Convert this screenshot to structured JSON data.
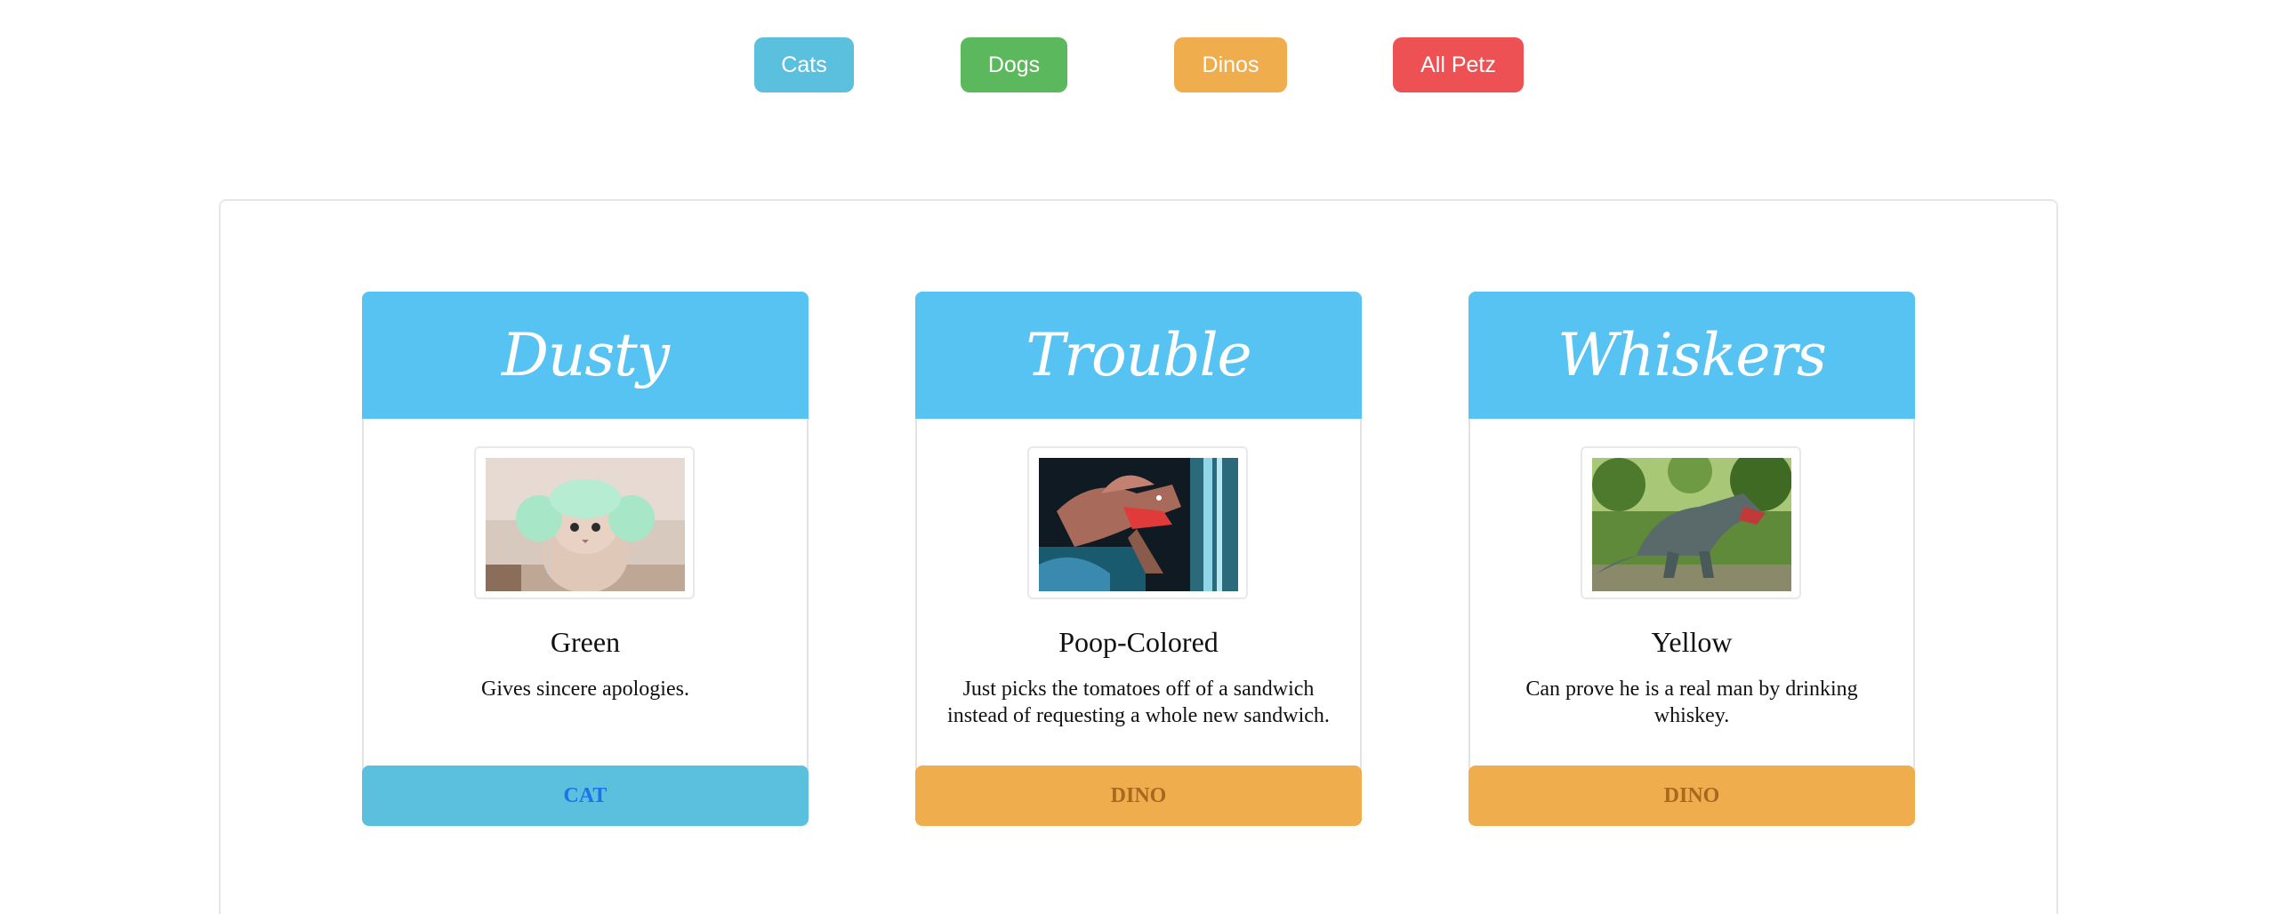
{
  "filters": [
    {
      "label": "Cats",
      "color": "#5bc0de"
    },
    {
      "label": "Dogs",
      "color": "#5cb85c"
    },
    {
      "label": "Dinos",
      "color": "#f0ad4e"
    },
    {
      "label": "All Petz",
      "color": "#ee5154"
    }
  ],
  "cards": [
    {
      "name": "Dusty",
      "header_color": "#56c3f3",
      "image_alt": "cat-with-green-yarn",
      "color": "Green",
      "description": "Gives sincere apologies.",
      "type_label": "CAT",
      "footer_color": "#5bc0de",
      "footer_text_color": "#1a73e8"
    },
    {
      "name": "Trouble",
      "header_color": "#56c3f3",
      "image_alt": "spinosaurus-model",
      "color": "Poop-Colored",
      "description": "Just picks the tomatoes off of a sandwich instead of requesting a whole new sandwich.",
      "type_label": "DINO",
      "footer_color": "#f0ad4e",
      "footer_text_color": "#a8681d"
    },
    {
      "name": "Whiskers",
      "header_color": "#56c3f3",
      "image_alt": "t-rex-model-in-forest",
      "color": "Yellow",
      "description": "Can prove he is a real man by drinking whiskey.",
      "type_label": "DINO",
      "footer_color": "#f0ad4e",
      "footer_text_color": "#a8681d"
    }
  ]
}
